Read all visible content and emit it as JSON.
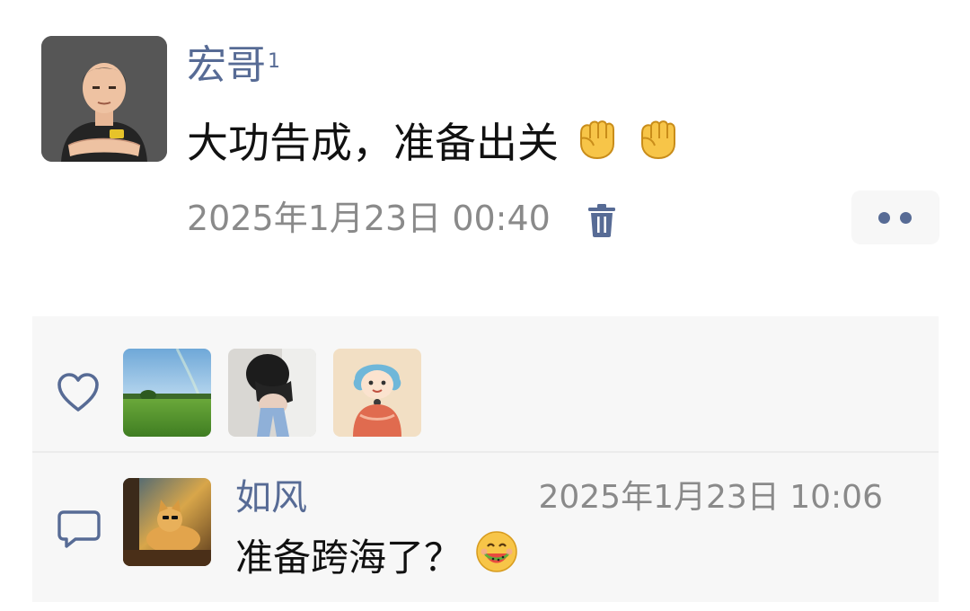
{
  "post": {
    "author": "宏哥",
    "author_badge": "1",
    "text": "大功告成，准备出关",
    "emojis": [
      "raised-fist-emoji",
      "raised-fist-emoji"
    ],
    "timestamp": "2025年1月23日 00:40"
  },
  "icons": {
    "delete": "trash-icon",
    "more": "more-dots-icon",
    "like": "heart-outline-icon",
    "comment": "comment-bubble-icon"
  },
  "likes": {
    "avatars": [
      "green-field-avatar",
      "person-photo-avatar",
      "cartoon-girl-avatar"
    ]
  },
  "comments": [
    {
      "name": "如风",
      "time": "2025年1月23日 10:06",
      "text": "准备跨海了？",
      "emoji": "watermelon-face-emoji"
    }
  ],
  "colors": {
    "link_blue": "#576b95",
    "meta_gray": "#8a8a8a",
    "panel_bg": "#f7f7f7"
  }
}
